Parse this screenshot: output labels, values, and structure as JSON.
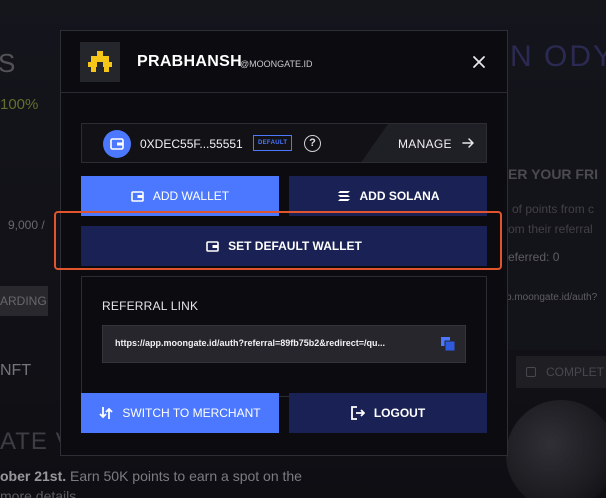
{
  "background": {
    "partial_heading": "S",
    "percent": "100%",
    "count": "9,000 /",
    "left_button": "ARDING",
    "nft": "NFT",
    "banner_partial": "ATE V",
    "date_bold": "ober 21st.",
    "date_text": " Earn 50K points to earn a spot on the",
    "more_details": "more details",
    "right_heading": "N ODY",
    "invite_title": "ER YOUR FRI",
    "invite_sub1": "of points from c",
    "invite_sub2": "om their referral",
    "referred": "eferred:  0",
    "link": "p.moongate.id/auth?",
    "complete": "COMPLET"
  },
  "modal": {
    "username": "PRABHANSH",
    "domain": "@MOONGATE.ID",
    "wallet": {
      "address": "0XDEC55F...55551",
      "badge": "DEFAULT",
      "manage_label": "MANAGE"
    },
    "buttons": {
      "add_wallet": "ADD WALLET",
      "add_solana": "ADD SOLANA",
      "set_default": "SET DEFAULT WALLET",
      "switch_merchant": "SWITCH TO MERCHANT",
      "logout": "LOGOUT"
    },
    "referral": {
      "label": "REFERRAL LINK",
      "url": "https://app.moongate.id/auth?referral=89fb75b2&redirect=/qu..."
    }
  },
  "colors": {
    "accent": "#4b78ff",
    "navy": "#1a2154",
    "highlight": "#e0552e"
  },
  "icons": [
    "close-icon",
    "wallet-icon",
    "help-icon",
    "arrow-right-icon",
    "solana-icon",
    "copy-icon",
    "switch-icon",
    "logout-icon"
  ]
}
